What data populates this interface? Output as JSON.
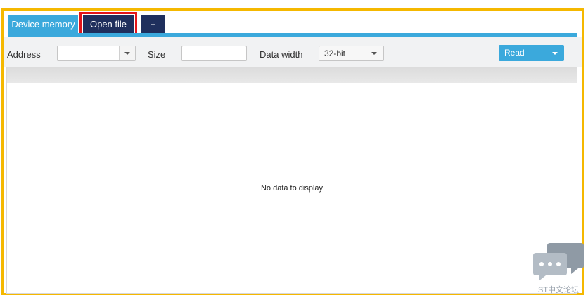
{
  "tabs": {
    "device_memory": "Device memory",
    "open_file": "Open file",
    "add": "+"
  },
  "toolbar": {
    "address_label": "Address",
    "size_label": "Size",
    "data_width_label": "Data width",
    "data_width_value": "32-bit",
    "read_label": "Read"
  },
  "grid": {
    "empty_message": "No data to display"
  },
  "watermark": {
    "text": "ST中文论坛"
  },
  "colors": {
    "tab_active": "#3ba9dc",
    "tab_dark": "#1f2f5d",
    "frame_highlight": "#f5b800",
    "tab_highlight": "#e3151a"
  }
}
